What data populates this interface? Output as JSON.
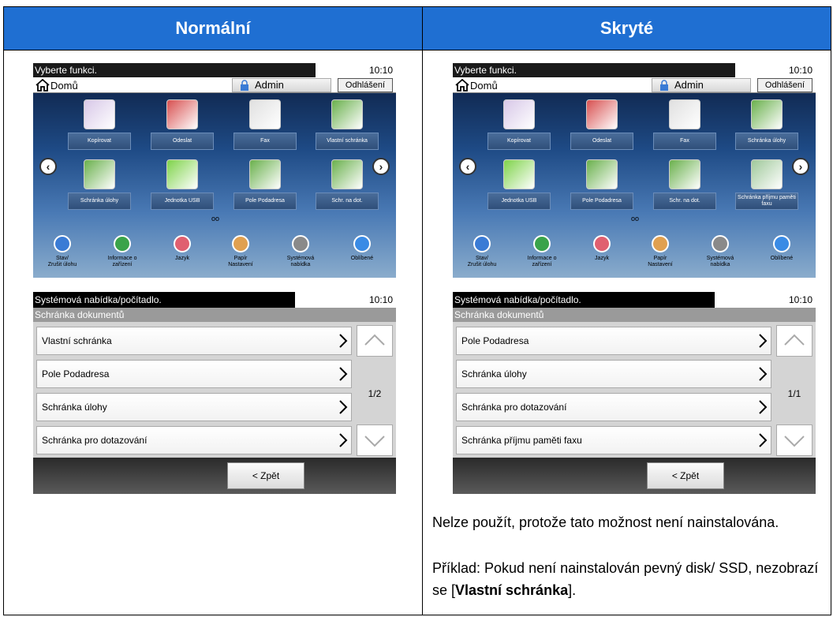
{
  "columns": {
    "normal": "Normální",
    "hidden": "Skryté"
  },
  "home_common": {
    "title": "Vyberte funkci.",
    "time": "10:10",
    "home_label": "Domů",
    "admin_label": "Admin",
    "logout_label": "Odhlášení",
    "nav_left": "‹",
    "nav_right": "›",
    "dots": "oo",
    "bottom": [
      "Stav/\nZrušit úlohu",
      "Informace o\nzařízení",
      "Jazyk",
      "Papír\nNastavení",
      "Systémová\nnabídka",
      "Oblíbené"
    ]
  },
  "home_normal": {
    "tiles": [
      "Kopírovat",
      "Odeslat",
      "Fax",
      "Vlastní schránka",
      "Schránka úlohy",
      "Jednotka USB",
      "Pole Podadresa",
      "Schr. na dot."
    ]
  },
  "home_hidden": {
    "tiles": [
      "Kopírovat",
      "Odeslat",
      "Fax",
      "Schránka úlohy",
      "Jednotka USB",
      "Pole Podadresa",
      "Schr. na dot.",
      "Schránka příjmu\npaměti faxu"
    ]
  },
  "sys_common": {
    "title": "Systémová nabídka/počítadlo.",
    "time": "10:10",
    "subtitle": "Schránka dokumentů",
    "back": "< Zpět"
  },
  "sys_normal": {
    "items": [
      "Vlastní schránka",
      "Pole Podadresa",
      "Schránka úlohy",
      "Schránka pro dotazování"
    ],
    "page": "1/2"
  },
  "sys_hidden": {
    "items": [
      "Pole Podadresa",
      "Schránka úlohy",
      "Schránka pro dotazování",
      "Schránka příjmu paměti faxu"
    ],
    "page": "1/1"
  },
  "notes": {
    "line1": "Nelze použít, protože tato možnost není nainstalována.",
    "line2_pre": "Příklad: Pokud není nainstalován pevný disk/ SSD, nezobrazí se [",
    "line2_bold": "Vlastní schránka",
    "line2_post": "]."
  },
  "colors": {
    "header": "#1f6fd2"
  }
}
